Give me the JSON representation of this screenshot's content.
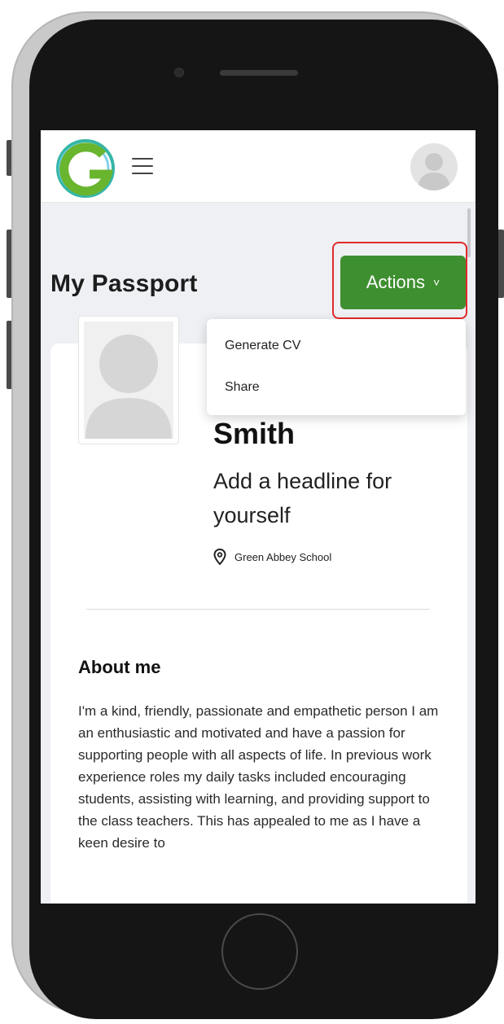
{
  "header": {
    "logo_icon": "g-logo-icon",
    "menu_icon": "hamburger-menu-icon",
    "avatar_icon": "user-avatar-icon"
  },
  "page": {
    "title": "My Passport"
  },
  "actions": {
    "label": "Actions",
    "chevron": "˅",
    "accent_color": "#3e8f30",
    "highlight_color": "#e3292c",
    "menu": [
      {
        "label": "Generate CV"
      },
      {
        "label": "Share"
      }
    ]
  },
  "profile": {
    "name": "Smith",
    "headline": "Add a headline for yourself",
    "location": "Green Abbey School",
    "location_icon": "map-pin-icon"
  },
  "about": {
    "title": "About me",
    "text": "I'm a kind, friendly, passionate and empathetic person I am an enthusiastic and motivated and have a passion for supporting people with all aspects of life. In previous work experience roles my daily tasks included encouraging students, assisting with learning, and providing support to the class teachers. This has appealed to me as I have a keen desire to"
  }
}
